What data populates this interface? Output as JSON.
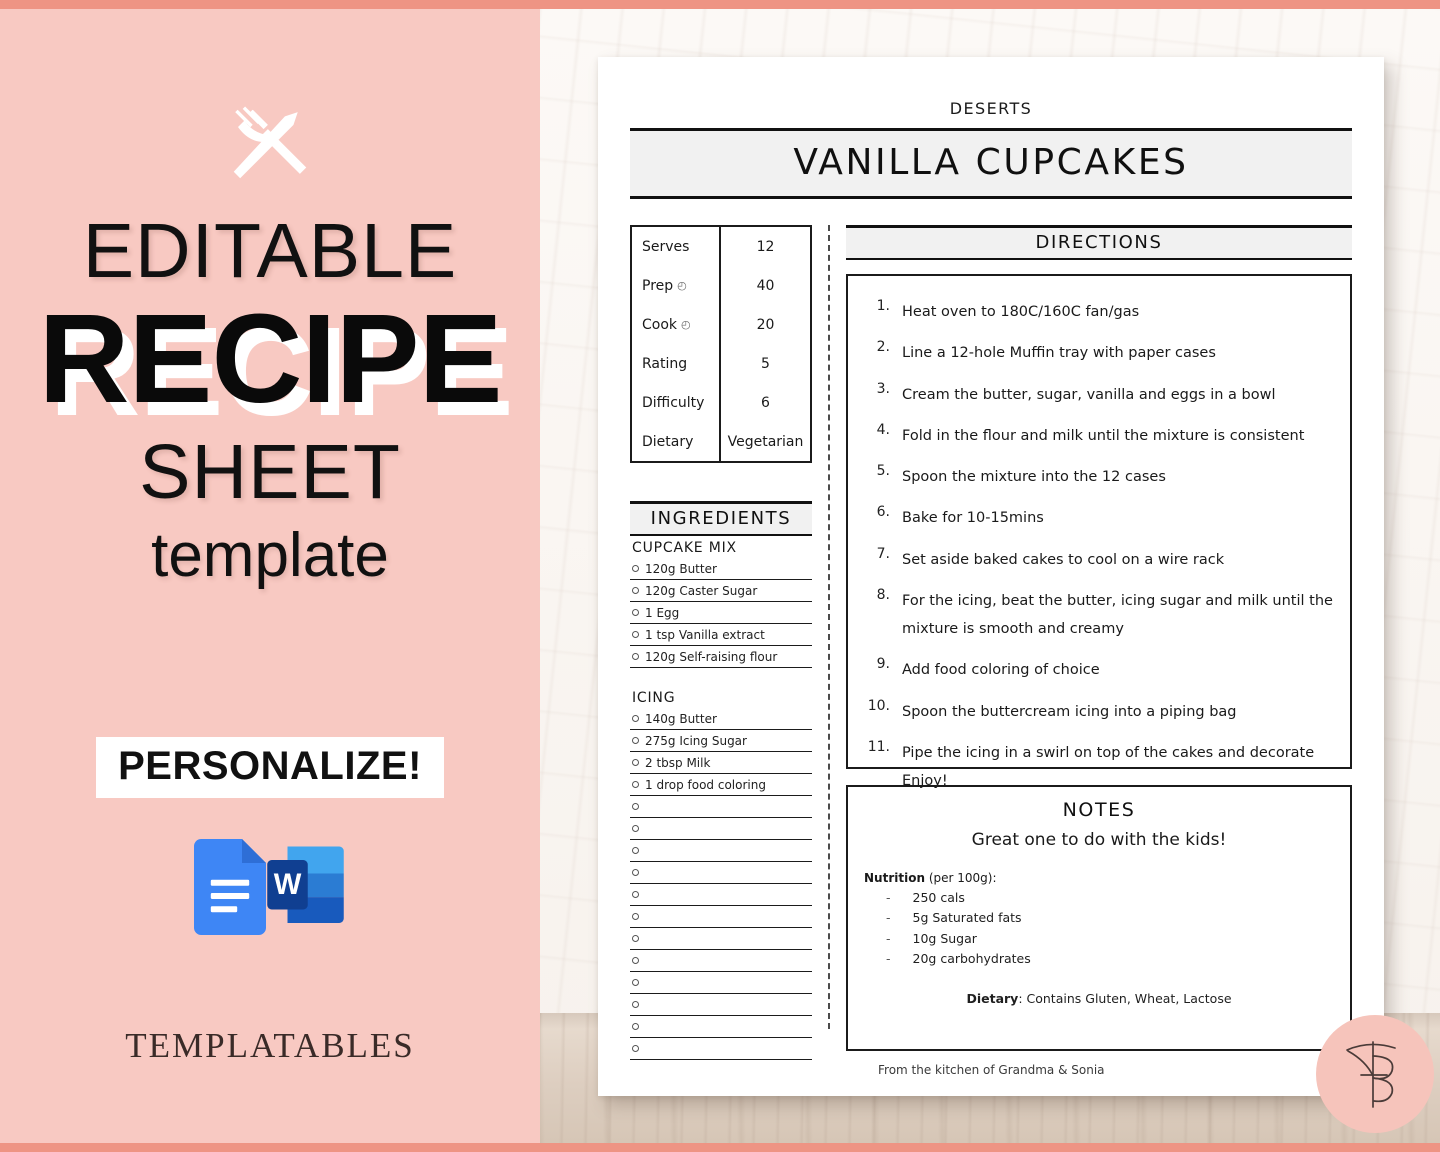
{
  "theme": {
    "frame_color": "#EE9484",
    "panel_pink": "#F8C9C2",
    "banner_gray": "#F1F1F1",
    "ink": "#111111",
    "stamp_pink": "#F6C4BB"
  },
  "promo": {
    "cutlery_icon": "fork-knife-cross-icon",
    "line1": "EDITABLE",
    "line2": "RECIPE",
    "line3": "SHEET",
    "line4": "template",
    "personalize_label": "PERSONALIZE!",
    "app_icons": [
      {
        "name": "google-docs-icon",
        "label": "Google Docs"
      },
      {
        "name": "microsoft-word-icon",
        "label": "Microsoft Word"
      }
    ],
    "brand_name": "TEMPLATABLES"
  },
  "sheet": {
    "category": "DESERTS",
    "title": "VANILLA CUPCAKES",
    "footer": "From the kitchen of Grandma & Sonia",
    "stamp_monogram": "TB"
  },
  "details": {
    "rows": [
      {
        "label": "Serves",
        "icon": "",
        "value": "12"
      },
      {
        "label": "Prep",
        "icon": "clock-icon",
        "value": "40"
      },
      {
        "label": "Cook",
        "icon": "clock-icon",
        "value": "20"
      },
      {
        "label": "Rating",
        "icon": "",
        "value": "5"
      },
      {
        "label": "Difficulty",
        "icon": "",
        "value": "6"
      },
      {
        "label": "Dietary",
        "icon": "",
        "value": "Vegetarian"
      }
    ]
  },
  "ingredients": {
    "heading": "INGREDIENTS",
    "groups": [
      {
        "title": "CUPCAKE MIX",
        "items": [
          "120g Butter",
          "120g Caster Sugar",
          "1 Egg",
          "1 tsp Vanilla extract",
          "120g Self-raising flour"
        ]
      },
      {
        "title": "ICING",
        "items": [
          "140g Butter",
          "275g Icing Sugar",
          "2 tbsp Milk",
          "1 drop food coloring"
        ]
      }
    ],
    "blank_line_count": 12
  },
  "directions": {
    "heading": "DIRECTIONS",
    "steps": [
      "Heat oven to 180C/160C fan/gas",
      "Line a 12-hole Muffin tray with paper cases",
      "Cream the butter, sugar, vanilla and eggs in a bowl",
      "Fold in the flour and milk until the mixture is consistent",
      "Spoon the mixture into the 12 cases",
      "Bake for 10-15mins",
      "Set aside baked cakes to cool on a wire rack",
      "For the icing, beat the butter, icing sugar and milk until the mixture is smooth and creamy",
      "Add food coloring of choice",
      "Spoon the buttercream icing into a piping bag",
      "Pipe the icing in a swirl on top of the cakes and decorate Enjoy!"
    ]
  },
  "notes": {
    "heading": "NOTES",
    "text": "Great one to do with the kids!",
    "nutrition_label": "Nutrition",
    "nutrition_qualifier": " (per 100g):",
    "nutrition_items": [
      "250 cals",
      "5g Saturated fats",
      "10g Sugar",
      "20g carbohydrates"
    ],
    "dietary_label": "Dietary",
    "dietary_value": ": Contains Gluten, Wheat, Lactose"
  }
}
